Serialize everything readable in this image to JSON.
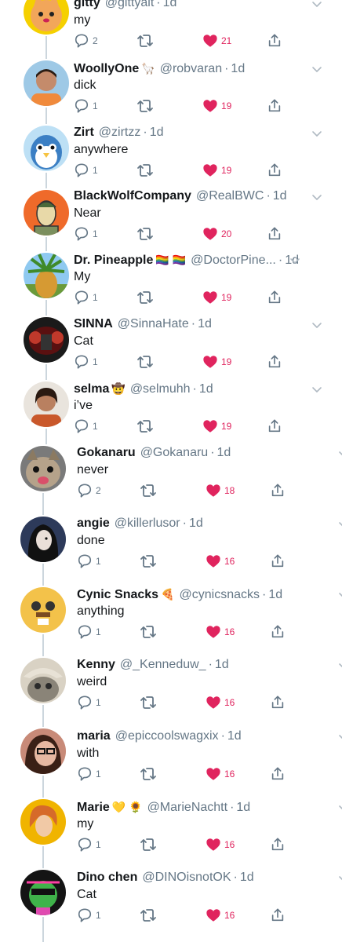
{
  "tweets": [
    {
      "name": "gitty",
      "badge": "",
      "handle": "@gittyalt",
      "time": "1d",
      "text": "my",
      "replies": "2",
      "likes": "21"
    },
    {
      "name": "WoollyOne",
      "badge": "🦙",
      "handle": "@robvaran",
      "time": "1d",
      "text": "dick",
      "replies": "1",
      "likes": "19"
    },
    {
      "name": "Zirt",
      "badge": "",
      "handle": "@zirtzz",
      "time": "1d",
      "text": "anywhere",
      "replies": "1",
      "likes": "19"
    },
    {
      "name": "BlackWolfCompany",
      "badge": "",
      "handle": "@RealBWC",
      "time": "1d",
      "text": "Near",
      "replies": "1",
      "likes": "20"
    },
    {
      "name": "Dr. Pineapple",
      "badge": "🏳️‍🌈 🏳️‍🌈",
      "handle": "@DoctorPine...",
      "time": "1d",
      "text": "My",
      "replies": "1",
      "likes": "19"
    },
    {
      "name": "SINNA",
      "badge": "",
      "handle": "@SinnaHate",
      "time": "1d",
      "text": "Cat",
      "replies": "1",
      "likes": "19"
    },
    {
      "name": "selma",
      "badge": "🤠",
      "handle": "@selmuhh",
      "time": "1d",
      "text": "i’ve",
      "replies": "1",
      "likes": "19"
    },
    {
      "name": "Gokanaru",
      "badge": "",
      "handle": "@Gokanaru",
      "time": "1d",
      "text": "never",
      "replies": "2",
      "likes": "18"
    },
    {
      "name": "angie",
      "badge": "",
      "handle": "@killerlusor",
      "time": "1d",
      "text": "done",
      "replies": "1",
      "likes": "16"
    },
    {
      "name": "Cynic Snacks",
      "badge": "🍕",
      "handle": "@cynicsnacks",
      "time": "1d",
      "text": "anything",
      "replies": "1",
      "likes": "16"
    },
    {
      "name": "Kenny",
      "badge": "",
      "handle": "@_Kenneduw_",
      "time": "1d",
      "text": "weird",
      "replies": "1",
      "likes": "16"
    },
    {
      "name": "maria",
      "badge": "",
      "handle": "@epiccoolswagxix",
      "time": "1d",
      "text": "with",
      "replies": "1",
      "likes": "16"
    },
    {
      "name": "Marie",
      "badge": "💛 🌻",
      "handle": "@MarieNachtt",
      "time": "1d",
      "text": "my",
      "replies": "1",
      "likes": "16"
    },
    {
      "name": "Dino chen",
      "badge": "",
      "handle": "@DINOisnotOK",
      "time": "1d",
      "text": "Cat",
      "replies": "1",
      "likes": "16"
    }
  ],
  "colors": {
    "like": "#e0245e",
    "icon": "#657786",
    "thread": "#ccd6dd",
    "text": "#14171a"
  }
}
